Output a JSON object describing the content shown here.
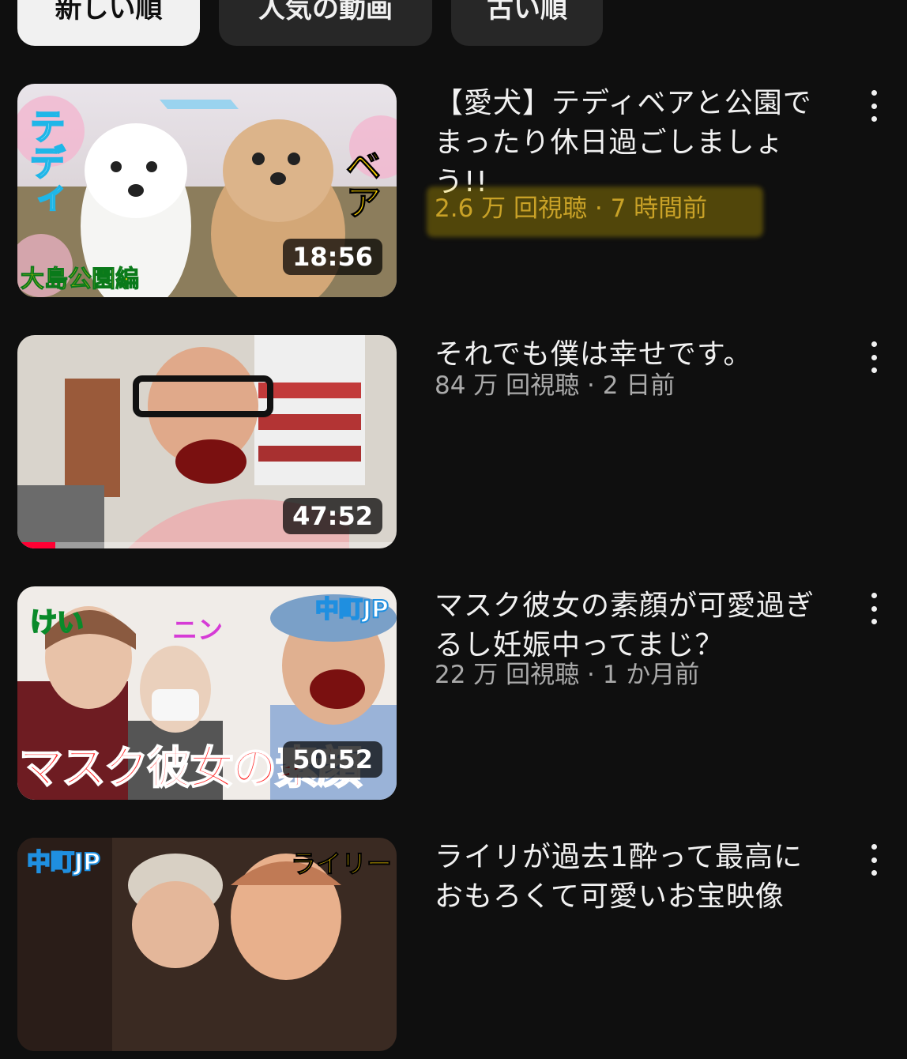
{
  "chips": [
    {
      "label": "新しい順",
      "selected": true
    },
    {
      "label": "人気の動画",
      "selected": false
    },
    {
      "label": "古い順",
      "selected": false
    }
  ],
  "videos": [
    {
      "title": "【愛犬】テディベアと公園でまったり休日過ごしましょう!!",
      "views": "2.6 万 回視聴",
      "age": "7 時間前",
      "duration": "18:56",
      "thumb_texts": {
        "left": "テディ",
        "right": "ベア",
        "bottom": "大島公園編"
      }
    },
    {
      "title": "それでも僕は幸せです。",
      "views": "84 万 回視聴",
      "age": "2 日前",
      "duration": "47:52",
      "watched_fraction": 0.1
    },
    {
      "title": "マスク彼女の素顔が可愛過ぎるし妊娠中ってまじ？",
      "views": "22 万 回視聴",
      "age": "1 か月前",
      "duration": "50:52",
      "thumb_texts": {
        "name1": "けい",
        "name2": "ニン",
        "channel": "中町JP",
        "caption": "マスク彼女の素顔"
      }
    },
    {
      "title": "ライリが過去1酔って最高におもろくて可愛いお宝映像",
      "views": "",
      "age": "",
      "duration": "",
      "thumb_texts": {
        "channel": "中町JP",
        "name": "ライリー"
      }
    }
  ],
  "meta_separator": "·",
  "colors": {
    "background": "#0f0f0f",
    "chip_selected": "#f1f1f1",
    "chip": "#272727",
    "progress": "#ff0033",
    "highlight": "#ffd700"
  }
}
